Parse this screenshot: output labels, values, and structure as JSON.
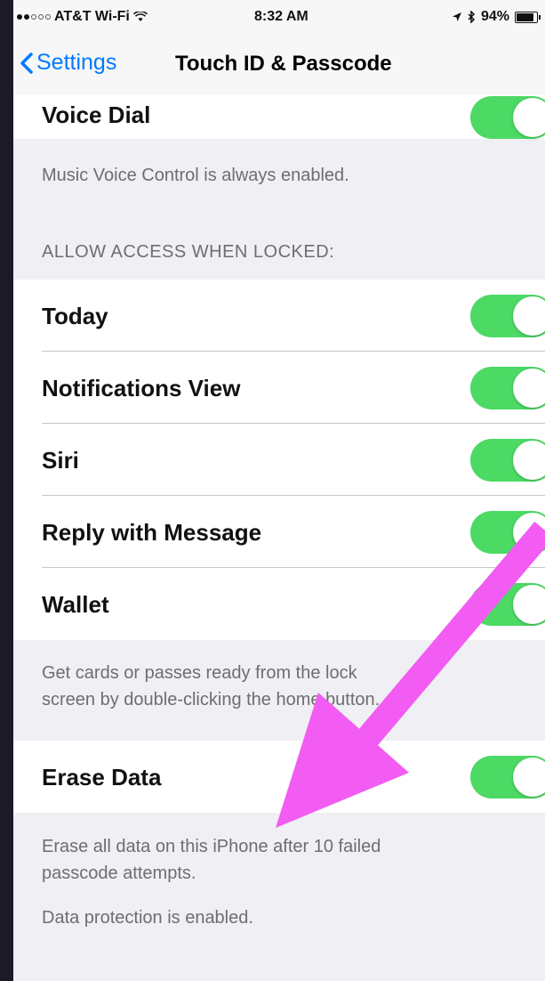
{
  "status": {
    "carrier": "AT&T Wi-Fi",
    "time": "8:32 AM",
    "battery": "94%",
    "battery_level": 0.94
  },
  "nav": {
    "back_label": "Settings",
    "title": "Touch ID & Passcode"
  },
  "voice_dial": {
    "label": "Voice Dial",
    "on": true,
    "footer": "Music Voice Control is always enabled."
  },
  "locked_access": {
    "header": "ALLOW ACCESS WHEN LOCKED:",
    "items": [
      {
        "label": "Today",
        "on": true
      },
      {
        "label": "Notifications View",
        "on": true
      },
      {
        "label": "Siri",
        "on": true
      },
      {
        "label": "Reply with Message",
        "on": true
      },
      {
        "label": "Wallet",
        "on": true
      }
    ],
    "footer_line1": "Get cards or passes ready from the lock",
    "footer_line2": "screen by double-clicking the home button."
  },
  "erase": {
    "label": "Erase Data",
    "on": true,
    "footer_line1": "Erase all data on this iPhone after 10 failed",
    "footer_line2": "passcode attempts.",
    "protection": "Data protection is enabled."
  },
  "colors": {
    "toggle_on": "#4cd964",
    "accent": "#007aff",
    "annotation_arrow": "#f25cf2"
  },
  "icons": [
    "wifi-icon",
    "location-arrow-icon",
    "bluetooth-icon",
    "battery-icon",
    "back-chevron-icon",
    "annotation-arrow"
  ]
}
